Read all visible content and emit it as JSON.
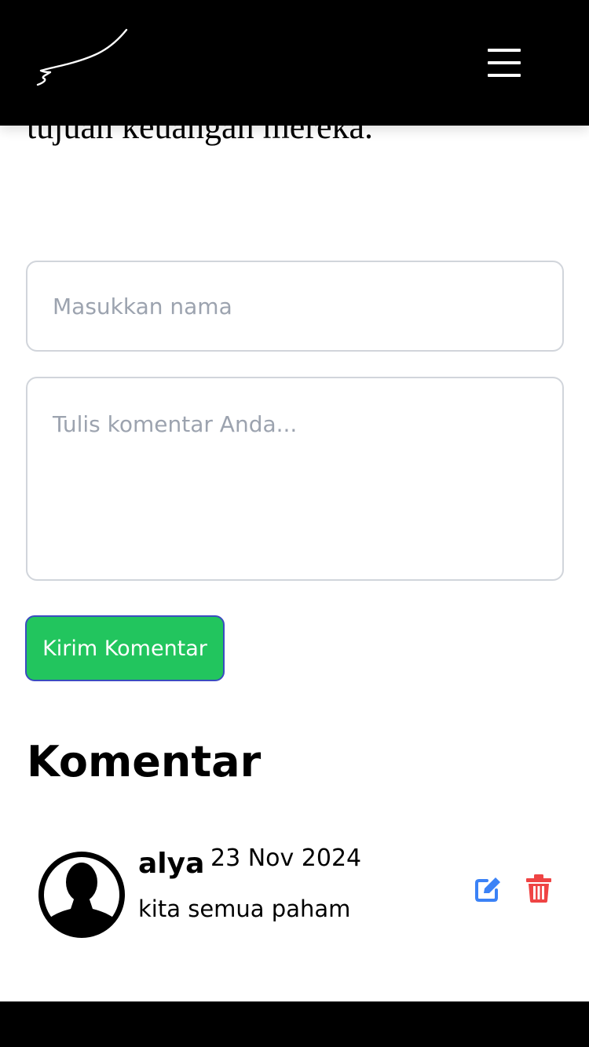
{
  "header": {
    "logo_icon": "signature-logo",
    "menu_icon": "hamburger-menu-icon"
  },
  "article": {
    "clipped_text": "tujuan keuangan mereka."
  },
  "form": {
    "name_placeholder": "Masukkan nama",
    "comment_placeholder": "Tulis komentar Anda...",
    "submit_label": "Kirim Komentar"
  },
  "comments_section": {
    "title": "Komentar",
    "comments": [
      {
        "author": "alya",
        "date": "23 Nov 2024",
        "text": "kita semua paham",
        "avatar_icon": "user-avatar-icon",
        "edit_icon": "edit-icon",
        "delete_icon": "trash-icon"
      }
    ]
  },
  "colors": {
    "header_bg": "#000000",
    "submit_bg": "#22c55e",
    "edit_icon": "#3b82f6",
    "delete_icon": "#ef4444",
    "input_border": "#d1d5db",
    "placeholder": "#9ca3af"
  }
}
